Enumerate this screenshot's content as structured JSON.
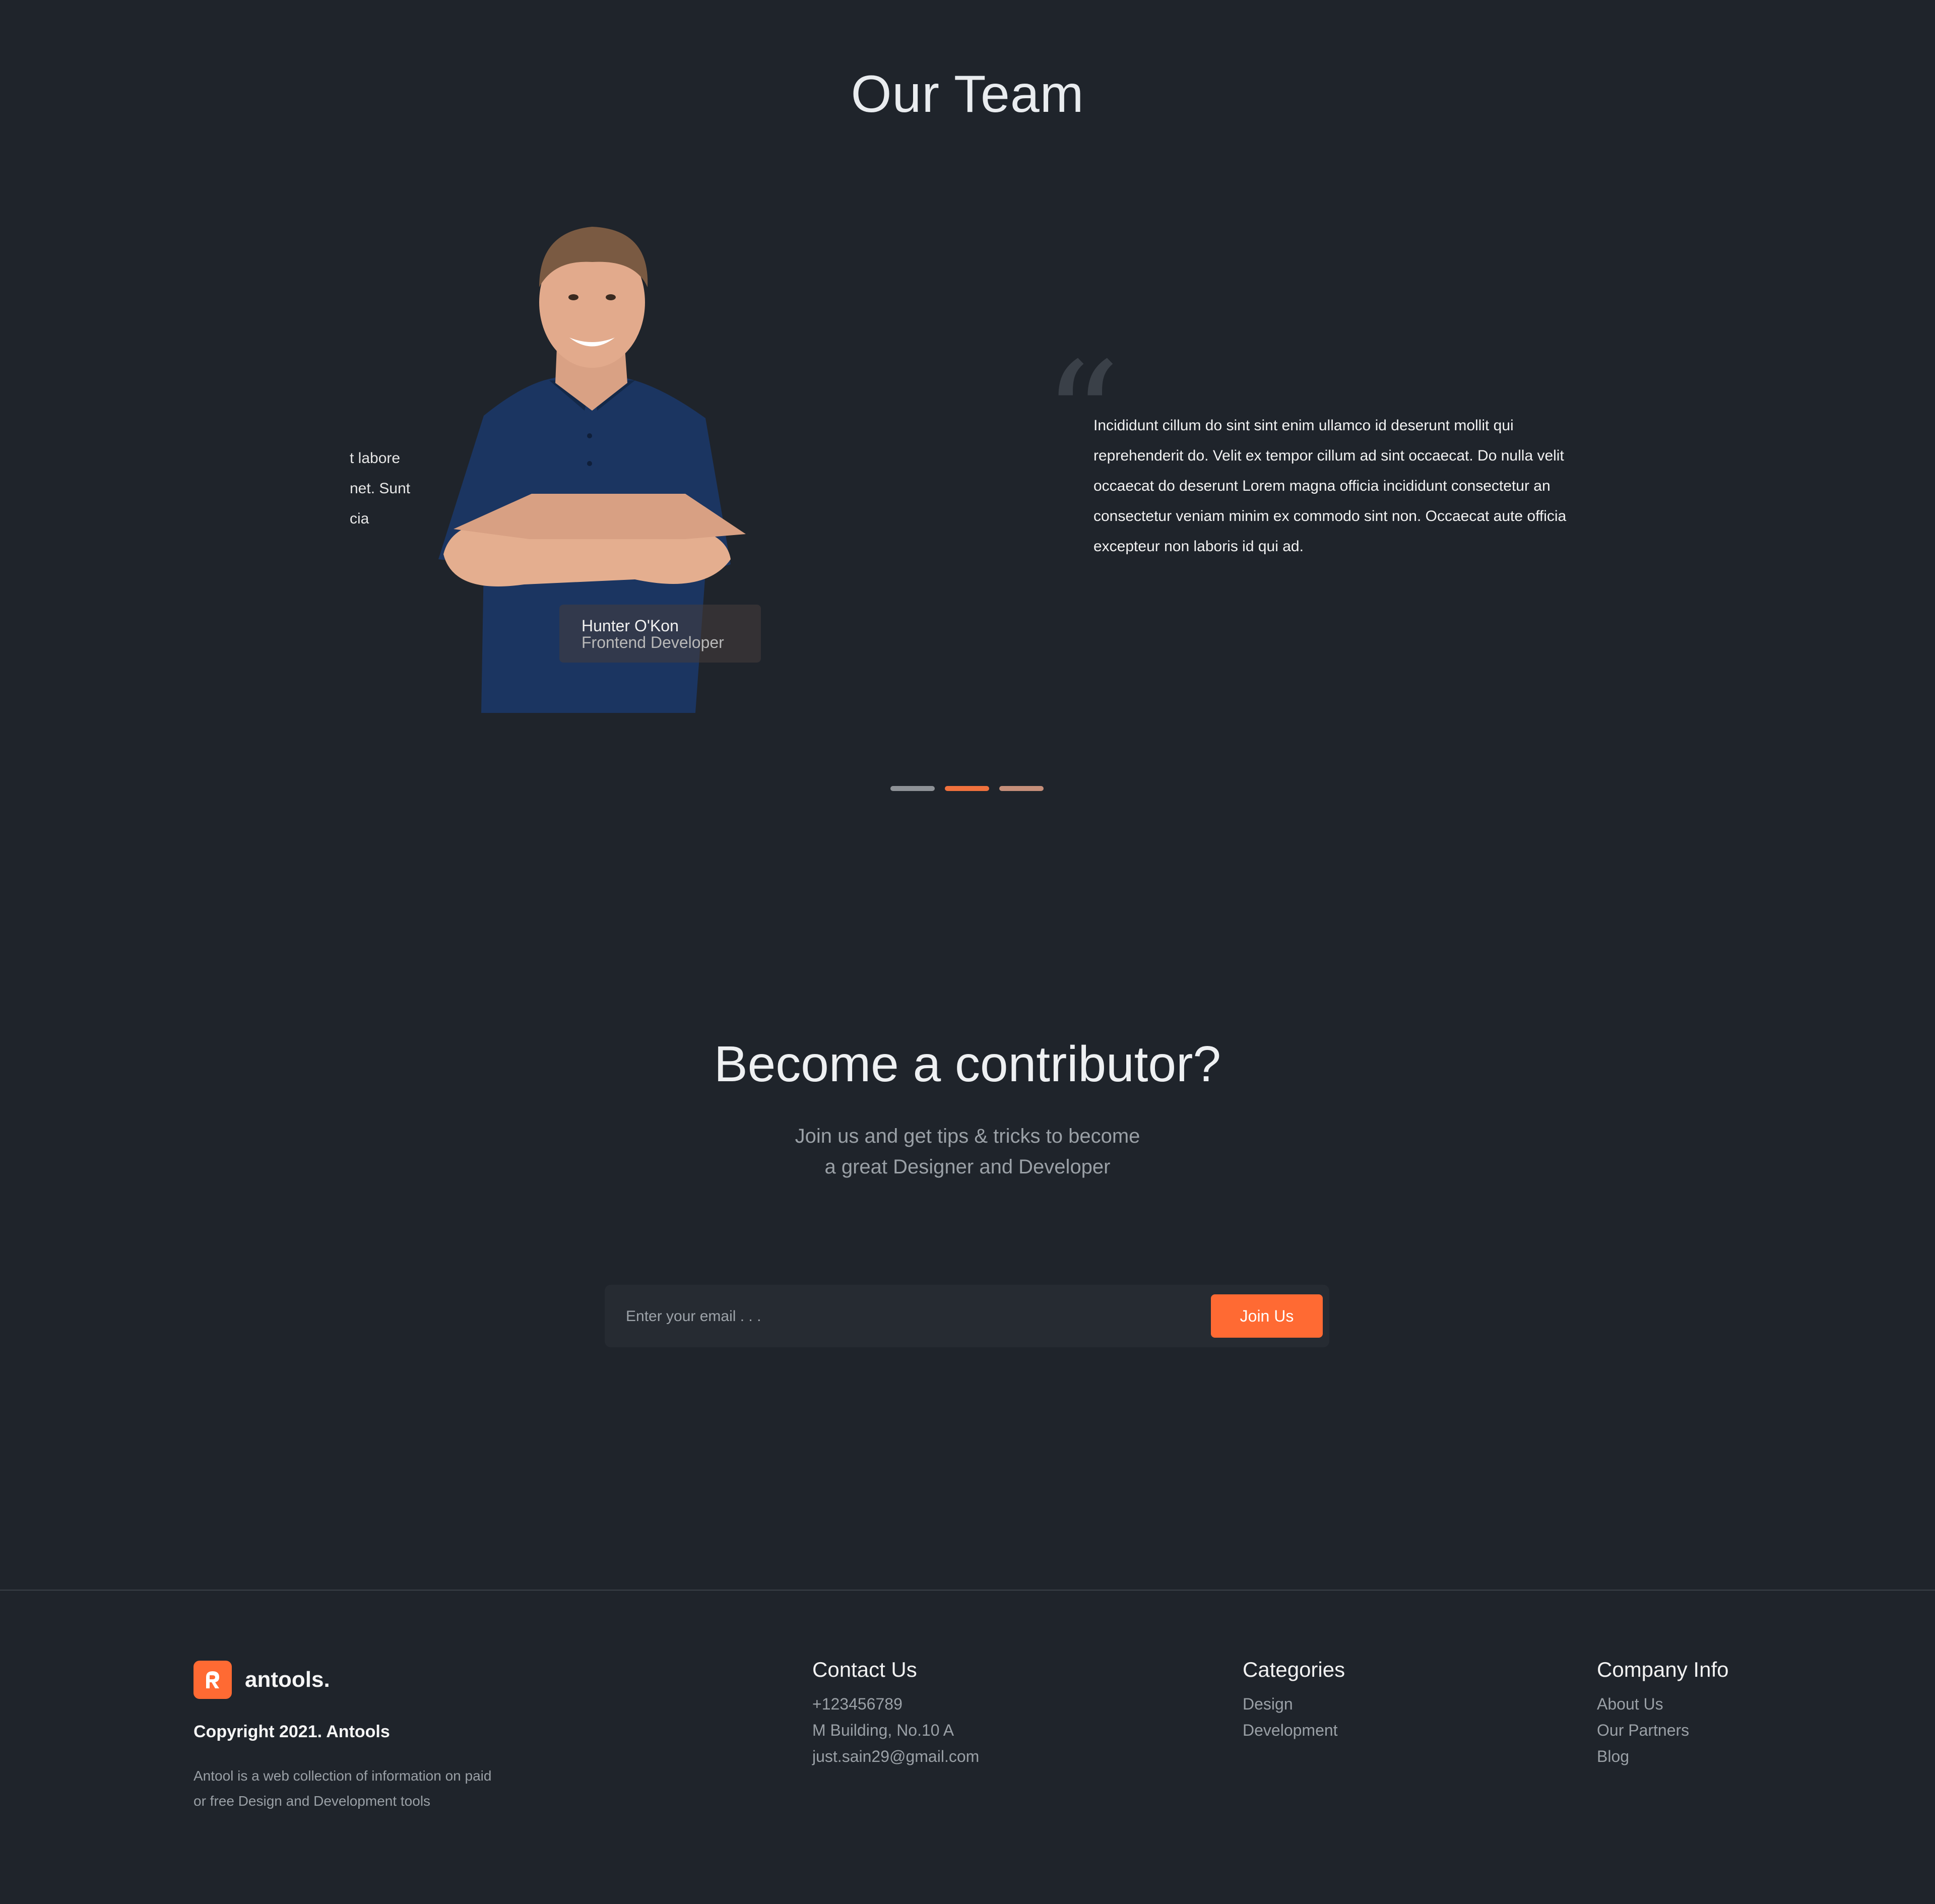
{
  "team": {
    "title": "Our Team",
    "prev_slide_fragment": [
      "t labore",
      "net. Sunt",
      "cia"
    ],
    "member": {
      "name": "Hunter O'Kon",
      "role": "Frontend Developer"
    },
    "quote_lines": [
      "Incididunt cillum do sint sint enim ullamco id deserunt mollit qui",
      "reprehenderit do. Velit ex tempor cillum ad sint occaecat. Do nulla velit",
      "occaecat do deserunt Lorem magna officia incididunt consectetur an",
      "consectetur veniam minim ex commodo sint non. Occaecat aute officia",
      "excepteur non laboris id qui ad."
    ],
    "slider": {
      "count": 3,
      "active_index": 1,
      "colors": [
        "#8e9297",
        "#f0713d",
        "#c58f7a"
      ]
    }
  },
  "contributor": {
    "title": "Become a contributor?",
    "subtitle_lines": [
      "Join us and get tips & tricks to become",
      "a great Designer and Developer"
    ],
    "email_placeholder": "Enter your email . . .",
    "button_label": "Join Us"
  },
  "footer": {
    "brand": "antools.",
    "copyright": "Copyright 2021. Antools",
    "about_lines": [
      "Antool is a web collection of information on paid",
      "or free Design and Development tools"
    ],
    "columns": [
      {
        "title": "Contact Us",
        "items": [
          "+123456789",
          "M Building, No.10 A",
          "just.sain29@gmail.com"
        ]
      },
      {
        "title": "Categories",
        "items": [
          "Design",
          "Development"
        ]
      },
      {
        "title": "Company Info",
        "items": [
          "About Us",
          "Our Partners",
          "Blog"
        ]
      }
    ]
  },
  "colors": {
    "background": "#1f242b",
    "accent": "#ff6a33",
    "muted_text": "#9aa0a6"
  }
}
